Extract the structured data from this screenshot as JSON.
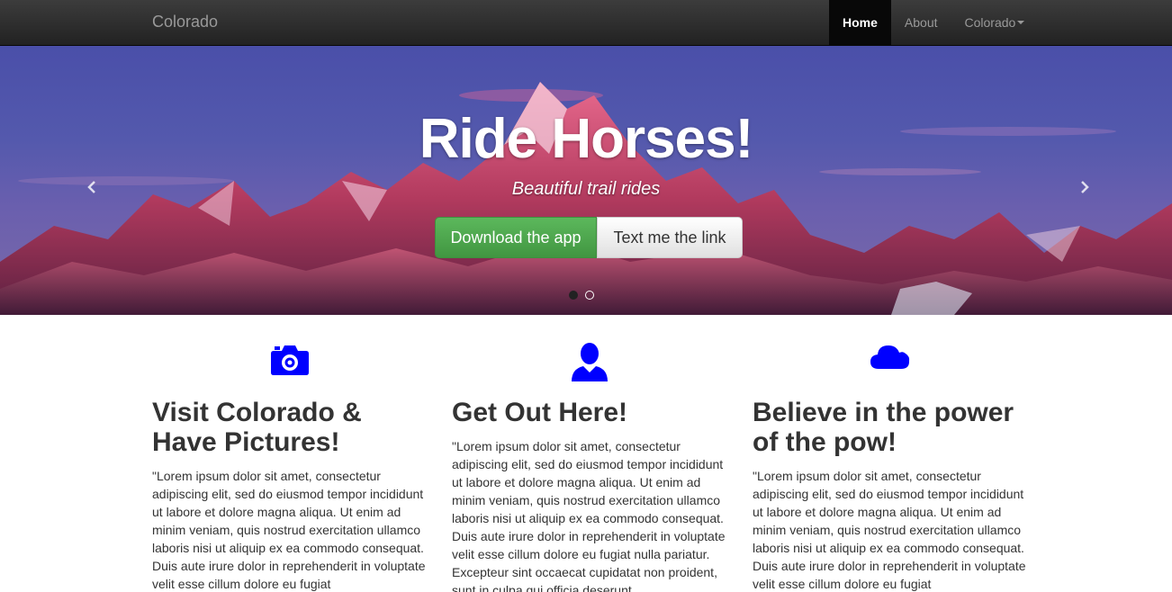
{
  "navbar": {
    "brand": "Colorado",
    "items": [
      {
        "label": "Home",
        "active": true
      },
      {
        "label": "About",
        "active": false
      },
      {
        "label": "Colorado",
        "active": false,
        "dropdown": true
      }
    ]
  },
  "hero": {
    "title": "Ride Horses!",
    "subtitle": "Beautiful trail rides",
    "primary_button": "Download the app",
    "secondary_button": "Text me the link",
    "prev_icon": "chevron-left-icon",
    "next_icon": "chevron-right-icon",
    "slides_total": 2,
    "active_slide": 1
  },
  "features": [
    {
      "icon": "camera-icon",
      "heading": "Visit Colorado & Have Pictures!",
      "text": "\"Lorem ipsum dolor sit amet, consectetur adipiscing elit, sed do eiusmod tempor incididunt ut labore et dolore magna aliqua. Ut enim ad minim veniam, quis nostrud exercitation ullamco laboris nisi ut aliquip ex ea commodo consequat. Duis aute irure dolor in reprehenderit in voluptate velit esse cillum dolore eu fugiat"
    },
    {
      "icon": "user-icon",
      "heading": "Get Out Here!",
      "text": "\"Lorem ipsum dolor sit amet, consectetur adipiscing elit, sed do eiusmod tempor incididunt ut labore et dolore magna aliqua. Ut enim ad minim veniam, quis nostrud exercitation ullamco laboris nisi ut aliquip ex ea commodo consequat. Duis aute irure dolor in reprehenderit in voluptate velit esse cillum dolore eu fugiat nulla pariatur. Excepteur sint occaecat cupidatat non proident, sunt in culpa qui officia deserunt"
    },
    {
      "icon": "cloud-icon",
      "heading": "Believe in the power of the pow!",
      "text": "\"Lorem ipsum dolor sit amet, consectetur adipiscing elit, sed do eiusmod tempor incididunt ut labore et dolore magna aliqua. Ut enim ad minim veniam, quis nostrud exercitation ullamco laboris nisi ut aliquip ex ea commodo consequat. Duis aute irure dolor in reprehenderit in voluptate velit esse cillum dolore eu fugiat"
    }
  ],
  "colors": {
    "icon": "#0000ff",
    "navbar": "#222222",
    "success": "#5cb85c"
  }
}
